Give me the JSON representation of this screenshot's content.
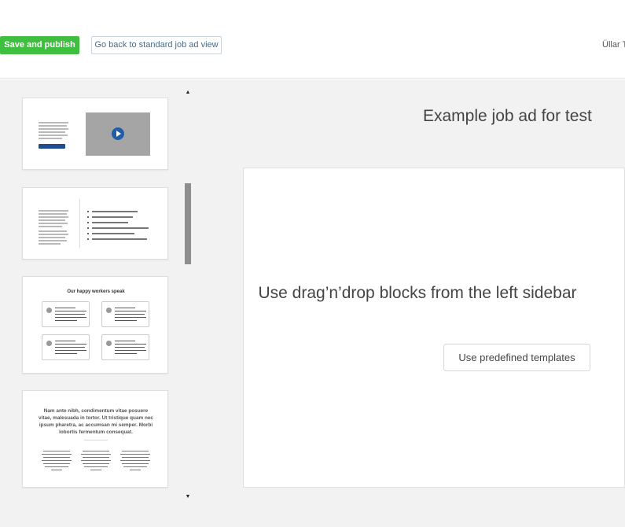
{
  "toolbar": {
    "publish_label": "Save and publish",
    "back_label": "Go back to standard job ad view",
    "user_name": "Üllar T"
  },
  "sidebar": {
    "templates": [
      {
        "name": "text-with-video",
        "button_label": "Watch video"
      },
      {
        "name": "text-with-bullets"
      },
      {
        "name": "testimonials",
        "title": "Our happy workers speak"
      },
      {
        "name": "quote-with-columns",
        "quote": "Nam ante nibh, condimentum vitae posuere vitae, malesuada in tortor. Ut tristique quam nec ipsum pharetra, ac accumsan mi semper. Morbi lobortis fermentum consequat."
      }
    ]
  },
  "main": {
    "job_title": "Example job ad for test",
    "drop_text": "Use drag’n’drop blocks from the left sidebar",
    "templates_button": "Use predefined templates"
  },
  "colors": {
    "publish_green": "#3fbf3f",
    "accent_blue": "#1e5fa8"
  }
}
